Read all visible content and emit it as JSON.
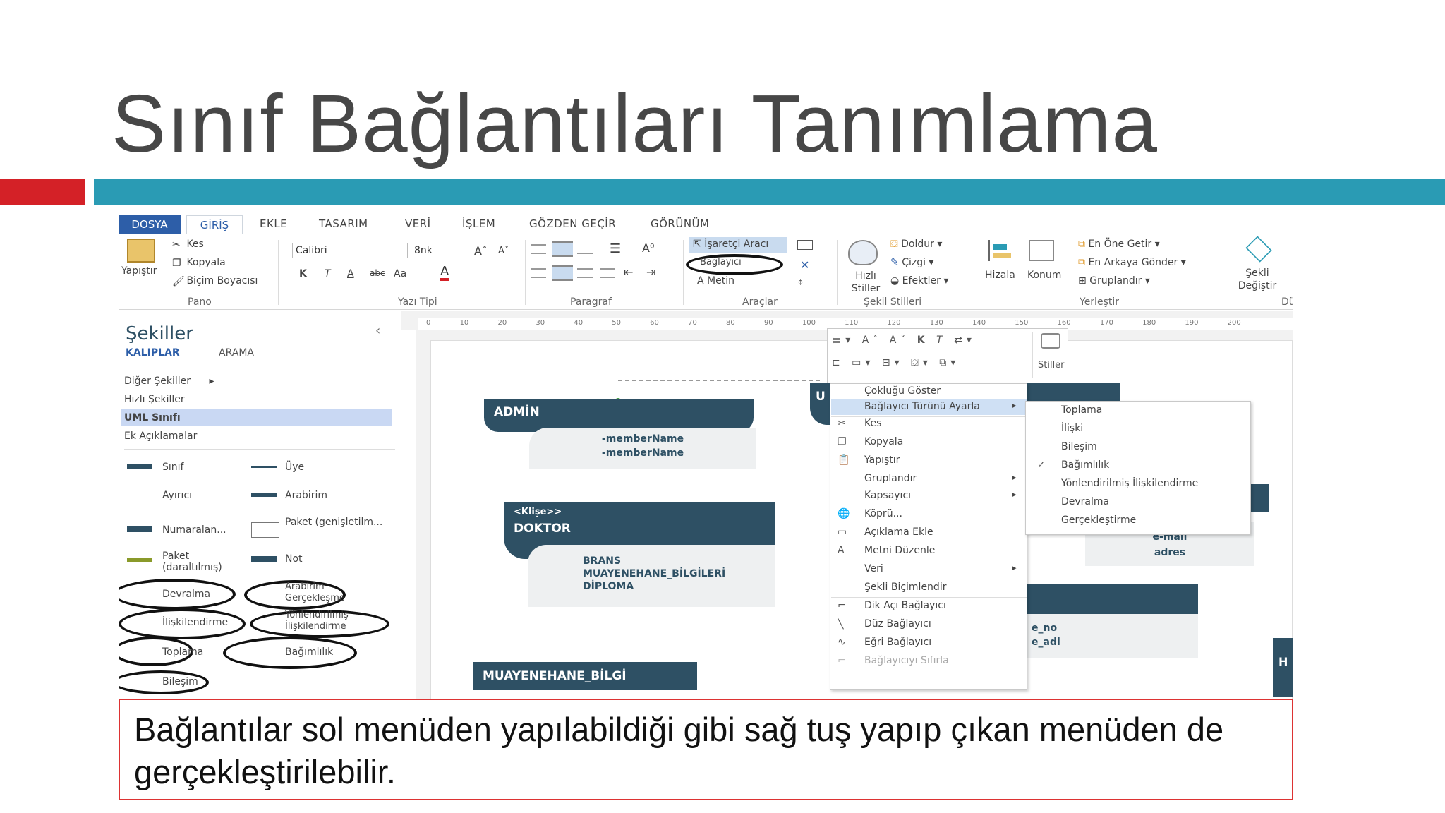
{
  "slide": {
    "title": "Sınıf  Bağlantıları Tanımlama",
    "note": "Bağlantılar sol menüden yapılabildiği gibi sağ tuş yapıp çıkan menüden de gerçekleştirilebilir."
  },
  "ribbon": {
    "tabs": [
      "DOSYA",
      "GİRİŞ",
      "EKLE",
      "TASARIM",
      "VERİ",
      "İŞLEM",
      "GÖZDEN GEÇİR",
      "GÖRÜNÜM"
    ],
    "pano": {
      "paste": "Yapıştır",
      "cut": "Kes",
      "copy": "Kopyala",
      "format_painter": "Biçim Boyacısı",
      "label": "Pano"
    },
    "font": {
      "family": "Calibri",
      "size": "8nk",
      "label": "Yazı Tipi",
      "bold": "K",
      "italic": "T",
      "underline": "A",
      "strike": "abc",
      "case": "Aa"
    },
    "paragraph": {
      "label": "Paragraf"
    },
    "tools": {
      "pointer": "İşaretçi Aracı",
      "connector": "Bağlayıcı",
      "text": "Metin",
      "label": "Araçlar"
    },
    "styles": {
      "quick": "Hızlı Stiller",
      "fill": "Doldur",
      "line": "Çizgi",
      "effects": "Efektler",
      "label": "Şekil Stilleri"
    },
    "arrange": {
      "align": "Hizala",
      "position": "Konum",
      "front": "En Öne Getir",
      "back": "En Arkaya Gönder",
      "group": "Gruplandır",
      "label": "Yerleştir"
    },
    "change_shape": "Şekli Değiştir",
    "cut_label": "Dü"
  },
  "shapes_panel": {
    "title": "Şekiller",
    "tabs": [
      "KALIPLAR",
      "ARAMA"
    ],
    "categories": [
      "Diğer Şekiller",
      "Hızlı Şekiller",
      "UML Sınıfı",
      "Ek Açıklamalar"
    ],
    "items": [
      "Sınıf",
      "Üye",
      "Ayırıcı",
      "Arabirim",
      "Numaralan...",
      "Paket (genişletilm...",
      "Paket (daraltılmış)",
      "Not",
      "Devralma",
      "Arabirim Gerçekleşme",
      "İlişkilendirme",
      "Yönlendirilmiş İlişkilendirme",
      "Toplama",
      "Bağımlılık",
      "Bileşim"
    ]
  },
  "ruler": {
    "h": [
      "0",
      "10",
      "20",
      "30",
      "40",
      "50",
      "60",
      "70",
      "80",
      "90",
      "100",
      "110",
      "120",
      "130",
      "140",
      "150",
      "160",
      "170",
      "180",
      "190",
      "200"
    ]
  },
  "diagram": {
    "admin": {
      "title": "ADMİN",
      "members": [
        "-memberName",
        "-memberName"
      ]
    },
    "doktor": {
      "stereotype": "<Klişe>>",
      "title": "DOKTOR",
      "members": [
        "BRANS",
        "MUAYENEHANE_BİLGİLERİ",
        "DİPLOMA"
      ]
    },
    "muayenehane": {
      "title": "MUAYENEHANE_BİLGİ"
    },
    "right_box": {
      "members": [
        "e-mail",
        "adres"
      ]
    },
    "right_box2": {
      "members": [
        "e_no",
        "e_adi"
      ]
    },
    "u_label": "U",
    "h_label": "H"
  },
  "mini_toolbar": {
    "styles": "Stiller"
  },
  "context_menu": {
    "items": [
      "Çokluğu Göster",
      "Bağlayıcı Türünü Ayarla",
      "Kes",
      "Kopyala",
      "Yapıştır",
      "Gruplandır",
      "Kapsayıcı",
      "Köprü...",
      "Açıklama Ekle",
      "Metni Düzenle",
      "Veri",
      "Şekli Biçimlendir",
      "Dik Açı Bağlayıcı",
      "Düz Bağlayıcı",
      "Eğri Bağlayıcı",
      "Bağlayıcıyı Sıfırla"
    ]
  },
  "submenu": {
    "items": [
      "Toplama",
      "İlişki",
      "Bileşim",
      "Bağımlılık",
      "Yönlendirilmiş İlişkilendirme",
      "Devralma",
      "Gerçekleştirme"
    ],
    "checked": "Bağımlılık"
  },
  "colors": {
    "red": "#d42127",
    "teal": "#2a9bb4",
    "uml": "#2e5064",
    "dosya": "#2d5ea8"
  }
}
